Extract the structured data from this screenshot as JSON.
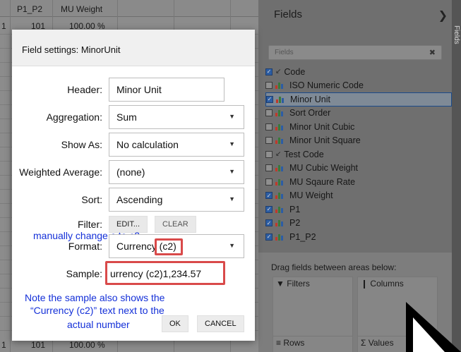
{
  "grid": {
    "headers": [
      "P1_P2",
      "MU Weight"
    ],
    "first_row": {
      "p1p2": "101",
      "mu_weight": "100.00 %"
    },
    "last_row": {
      "p1p2": "101",
      "mu_weight": "100.00 %"
    },
    "row_marker": "1"
  },
  "fields_panel": {
    "title": "Fields",
    "search_placeholder": "Fields",
    "items": [
      {
        "label": "Code",
        "checked": true,
        "kind": "tree",
        "selected": false
      },
      {
        "label": "ISO Numeric Code",
        "checked": false,
        "kind": "bar",
        "selected": false
      },
      {
        "label": "Minor Unit",
        "checked": true,
        "kind": "bar",
        "selected": true
      },
      {
        "label": "Sort Order",
        "checked": false,
        "kind": "bar",
        "selected": false
      },
      {
        "label": "Minor Unit Cubic",
        "checked": false,
        "kind": "bar",
        "selected": false
      },
      {
        "label": "Minor Unit Square",
        "checked": false,
        "kind": "bar",
        "selected": false
      },
      {
        "label": "Test Code",
        "checked": false,
        "kind": "tree",
        "selected": false
      },
      {
        "label": "MU Cubic Weight",
        "checked": false,
        "kind": "bar",
        "selected": false
      },
      {
        "label": "MU Sqaure Rate",
        "checked": false,
        "kind": "bar",
        "selected": false
      },
      {
        "label": "MU Weight",
        "checked": true,
        "kind": "bar",
        "selected": false
      },
      {
        "label": "P1",
        "checked": true,
        "kind": "bar",
        "selected": false
      },
      {
        "label": "P2",
        "checked": true,
        "kind": "bar",
        "selected": false
      },
      {
        "label": "P1_P2",
        "checked": true,
        "kind": "bar",
        "selected": false
      }
    ],
    "drag_text": "Drag fields between areas below:",
    "areas": {
      "filters": "Filters",
      "columns": "Columns",
      "rows": "Rows",
      "values": "Values"
    },
    "side_tab": "Fields"
  },
  "dialog": {
    "title": "Field settings: MinorUnit",
    "header_label": "Header:",
    "header_value": "Minor Unit",
    "aggregation_label": "Aggregation:",
    "aggregation_value": "Sum",
    "show_as_label": "Show As:",
    "show_as_value": "No calculation",
    "weighted_label": "Weighted Average:",
    "weighted_value": "(none)",
    "sort_label": "Sort:",
    "sort_value": "Ascending",
    "filter_label": "Filter:",
    "edit_btn": "EDIT...",
    "clear_btn": "CLEAR",
    "format_label": "Format:",
    "format_value": "Currency (c2)",
    "sample_label": "Sample:",
    "sample_value": "urrency (c2)1,234.57",
    "ok_btn": "OK",
    "cancel_btn": "CANCEL"
  },
  "annotations": {
    "format_note": "manually change c to c2",
    "sample_note_line1": "Note the sample also shows the",
    "sample_note_line2": "“Currency (c2)” text next to the",
    "sample_note_line3": "actual number"
  },
  "colors": {
    "annotation_blue": "#1430d8",
    "highlight_red": "#d94a4a",
    "selected_field_border": "#1a4a8a"
  }
}
